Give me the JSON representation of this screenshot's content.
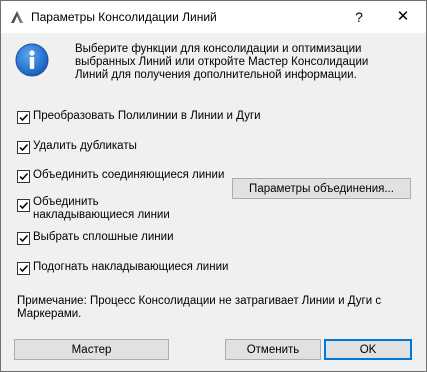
{
  "window": {
    "title": "Параметры Консолидации Линий",
    "help_label": "?",
    "close_label": "✕"
  },
  "info": {
    "text": "Выберите функции для консолидации и оптимизации выбранных Линий или откройте Мастер Консолидации Линий для получения дополнительной информации."
  },
  "options": [
    {
      "label": "Преобразовать Полилинии в Линии и Дуги",
      "checked": true
    },
    {
      "label": "Удалить дубликаты",
      "checked": true
    },
    {
      "label": "Объединить соединяющиеся линии",
      "checked": true
    },
    {
      "label": "Объединить накладывающиеся линии",
      "checked": true
    },
    {
      "label": "Выбрать сплошные линии",
      "checked": true
    },
    {
      "label": "Подогнать накладывающиеся линии",
      "checked": true
    }
  ],
  "buttons": {
    "merge_params": "Параметры объединения...",
    "wizard": "Мастер",
    "cancel": "Отменить",
    "ok": "OK"
  },
  "note": "Примечание: Процесс Консолидации не затрагивает Линии и Дуги с Маркерами.",
  "colors": {
    "info_icon": "#1a6fd1",
    "accent_border": "#0078d7"
  }
}
